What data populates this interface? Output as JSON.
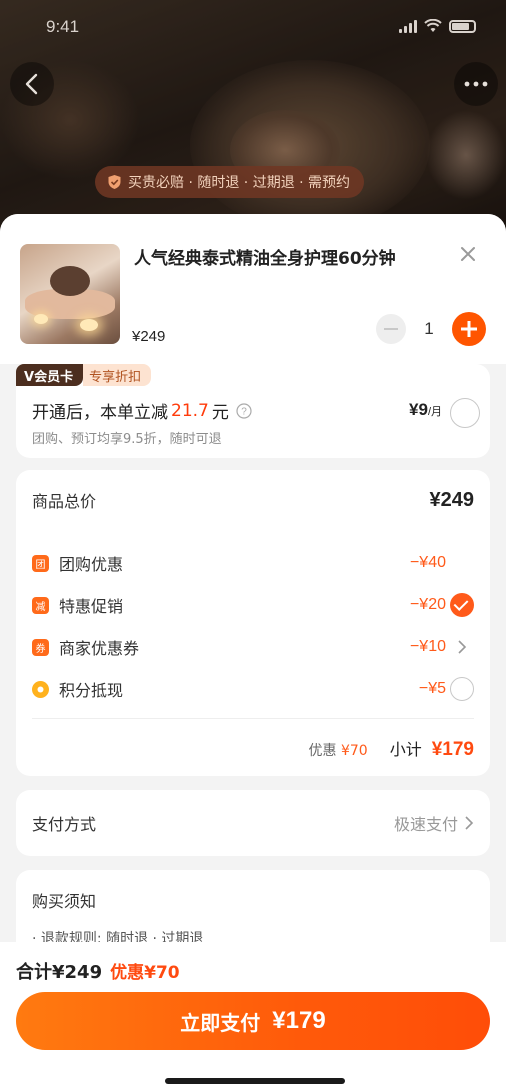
{
  "status_bar": {
    "time": "9:41"
  },
  "hero": {
    "guarantee_text": "买贵必赔 · 随时退 · 过期退 · 需预约"
  },
  "product": {
    "title": "人气经典泰式精油全身护理60分钟",
    "price": "¥249",
    "quantity": "1"
  },
  "member": {
    "tag_label": "会员卡",
    "tag_discount": "专享折扣",
    "main_prefix": "开通后，本单立减",
    "main_amount": "21.7",
    "main_unit": "元",
    "subtitle": "团购、预订均享9.5折，随时可退",
    "price": "¥9",
    "price_unit": "/月"
  },
  "breakdown": {
    "total_label": "商品总价",
    "total_value": "¥249",
    "items": [
      {
        "icon": "团",
        "label": "团购优惠",
        "value": "−¥40",
        "tail": "none"
      },
      {
        "icon": "减",
        "label": "特惠促销",
        "value": "−¥20",
        "tail": "check"
      },
      {
        "icon": "券",
        "label": "商家优惠券",
        "value": "−¥10",
        "tail": "chevron"
      },
      {
        "icon": "",
        "label": "积分抵现",
        "value": "−¥5",
        "tail": "radio"
      }
    ],
    "saved_label": "优惠",
    "saved_value": "¥70",
    "subtotal_label": "小计",
    "subtotal_value": "¥179"
  },
  "payment": {
    "label": "支付方式",
    "value": "极速支付"
  },
  "notes": {
    "heading": "购买须知",
    "line": "· 退款规则: 随时退 · 过期退"
  },
  "footer": {
    "total": "合计¥249",
    "discount": "优惠¥70",
    "pay_label": "立即支付",
    "pay_amount": "¥179"
  },
  "colors": {
    "accent": "#ff5500",
    "price_red": "#ff4a10",
    "member_dark": "#4c2e1f"
  }
}
